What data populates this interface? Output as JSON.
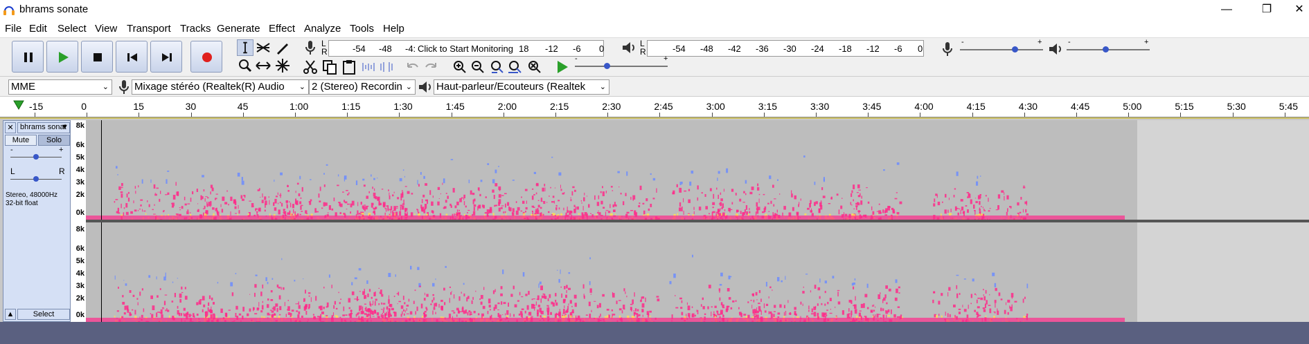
{
  "window": {
    "title": "bhrams sonate",
    "minimize": "—",
    "restore": "❐",
    "close": "✕"
  },
  "menu": [
    "File",
    "Edit",
    "Select",
    "View",
    "Transport",
    "Tracks",
    "Generate",
    "Effect",
    "Analyze",
    "Tools",
    "Help"
  ],
  "meters": {
    "record_scale": [
      "-54",
      "-48",
      "-4:"
    ],
    "monitor_text": "Click to Start Monitoring",
    "record_scale_right": [
      "18",
      "-12",
      "-6",
      "0"
    ],
    "playback_scale": [
      "-54",
      "-48",
      "-42",
      "-36",
      "-30",
      "-24",
      "-18",
      "-12",
      "-6",
      "0"
    ],
    "lr": "L\nR",
    "slider_minus": "-",
    "slider_plus": "+"
  },
  "devices": {
    "host": "MME",
    "recording_device": "Mixage stéréo (Realtek(R) Audio",
    "channels": "2 (Stereo) Recordin",
    "playback_device": "Haut-parleur/Ecouteurs (Realtek"
  },
  "timeline": {
    "labels": [
      "-15",
      "0",
      "15",
      "30",
      "45",
      "1:00",
      "1:15",
      "1:30",
      "1:45",
      "2:00",
      "2:15",
      "2:30",
      "2:45",
      "3:00",
      "3:15",
      "3:30",
      "3:45",
      "4:00",
      "4:15",
      "4:30",
      "4:45",
      "5:00",
      "5:15",
      "5:30",
      "5:45"
    ]
  },
  "track": {
    "name": "bhrams sonat",
    "mute": "Mute",
    "solo": "Solo",
    "gain_minus": "-",
    "gain_plus": "+",
    "pan_left": "L",
    "pan_right": "R",
    "info_line1": "Stereo, 48000Hz",
    "info_line2": "32-bit float",
    "select": "Select",
    "collapse": "▲",
    "close": "✕",
    "menu_arrow": "▼"
  },
  "freq_ruler": [
    "8k",
    "6k",
    "5k",
    "4k",
    "3k",
    "2k",
    "0k"
  ],
  "colors": {
    "spectrogram_low": "#6c8cff",
    "spectrogram_mid": "#ff2a8a",
    "spectrogram_high": "#ffdd55",
    "track_panel": "#d5e0f5",
    "toolbar_button": "#c9d4ea"
  }
}
